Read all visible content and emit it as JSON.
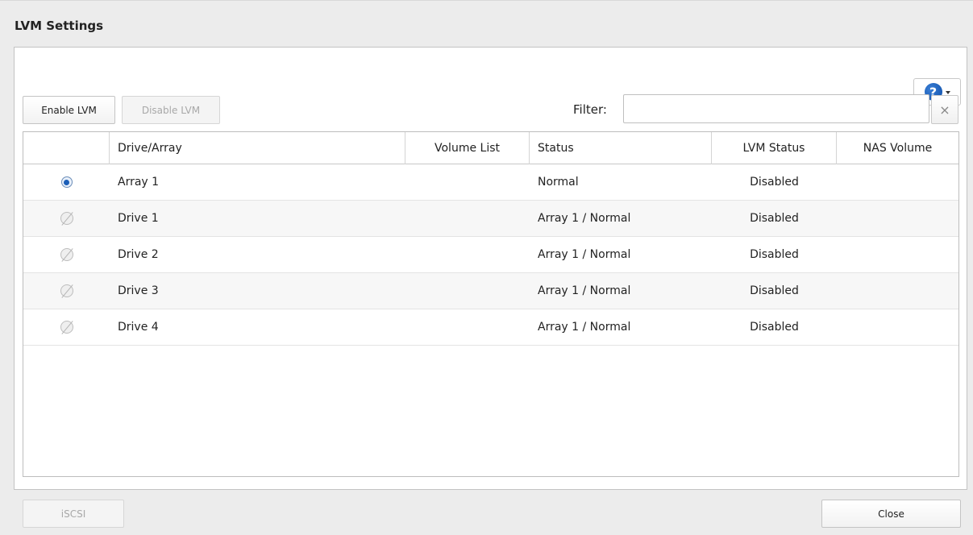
{
  "window": {
    "title": "LVM Settings"
  },
  "toolbar": {
    "enable_label": "Enable LVM",
    "disable_label": "Disable LVM",
    "filter_label": "Filter:",
    "filter_value": "",
    "clear_icon": "close-icon",
    "clear_glyph": "×",
    "help_glyph": "?"
  },
  "table": {
    "columns": [
      "",
      "Drive/Array",
      "Volume List",
      "Status",
      "LVM Status",
      "NAS Volume"
    ],
    "rows": [
      {
        "selected": true,
        "selectable": true,
        "drive": "Array 1",
        "volume_list": "",
        "status": "Normal",
        "lvm_status": "Disabled",
        "nas_volume": ""
      },
      {
        "selected": false,
        "selectable": false,
        "drive": "Drive 1",
        "volume_list": "",
        "status": "Array 1 / Normal",
        "lvm_status": "Disabled",
        "nas_volume": ""
      },
      {
        "selected": false,
        "selectable": false,
        "drive": "Drive 2",
        "volume_list": "",
        "status": "Array 1 / Normal",
        "lvm_status": "Disabled",
        "nas_volume": ""
      },
      {
        "selected": false,
        "selectable": false,
        "drive": "Drive 3",
        "volume_list": "",
        "status": "Array 1 / Normal",
        "lvm_status": "Disabled",
        "nas_volume": ""
      },
      {
        "selected": false,
        "selectable": false,
        "drive": "Drive 4",
        "volume_list": "",
        "status": "Array 1 / Normal",
        "lvm_status": "Disabled",
        "nas_volume": ""
      }
    ]
  },
  "footer": {
    "iscsi_label": "iSCSI",
    "close_label": "Close"
  },
  "colors": {
    "accent": "#1c5fb8",
    "background": "#ececec"
  }
}
